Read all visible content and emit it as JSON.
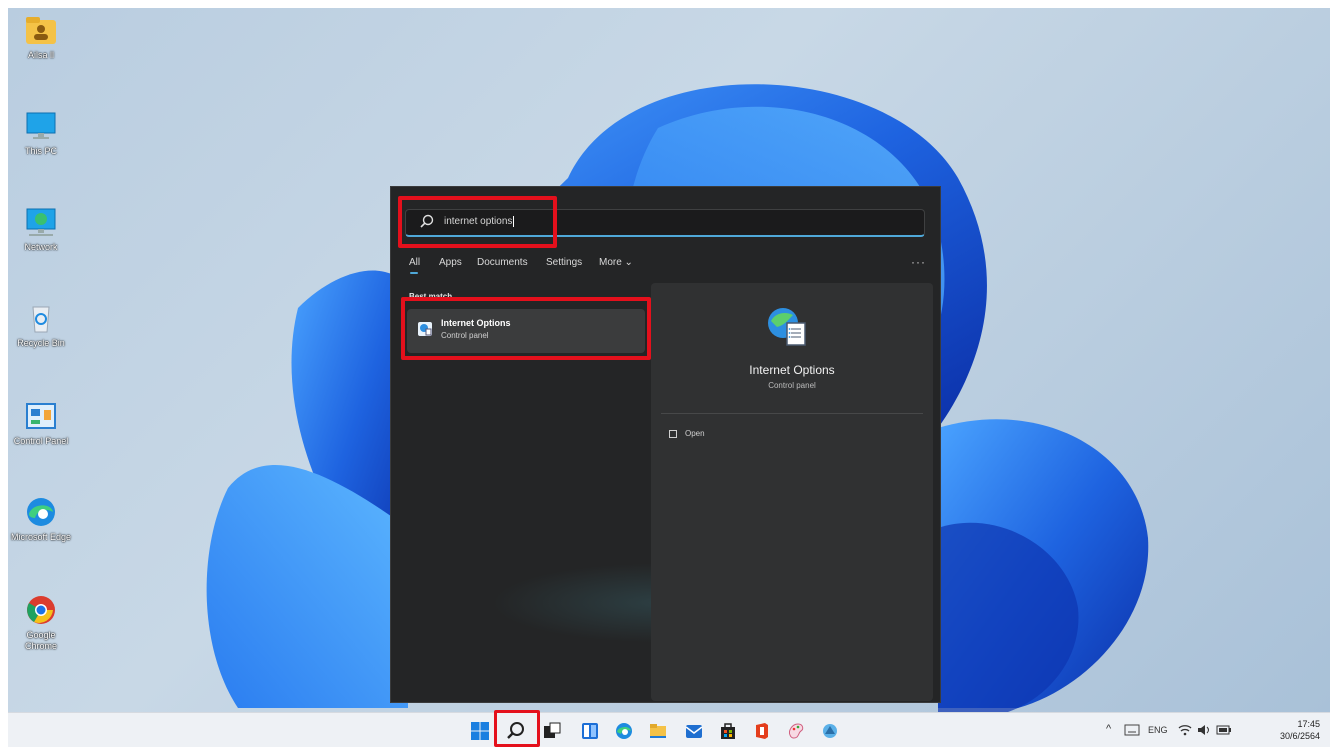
{
  "desktop": {
    "icons": [
      {
        "label": "Ailsa ll",
        "icon": "user-folder-icon"
      },
      {
        "label": "This PC",
        "icon": "computer-icon"
      },
      {
        "label": "Network",
        "icon": "network-icon"
      },
      {
        "label": "Recycle Bin",
        "icon": "recycle-bin-icon"
      },
      {
        "label": "Control Panel",
        "icon": "control-panel-icon"
      },
      {
        "label": "Microsoft Edge",
        "icon": "edge-icon"
      },
      {
        "label": "Google Chrome",
        "icon": "chrome-icon"
      }
    ]
  },
  "search": {
    "query": "internet options",
    "tabs": [
      "All",
      "Apps",
      "Documents",
      "Settings",
      "More ⌄"
    ],
    "active_tab": "All",
    "overflow": "···",
    "best_match_label": "Best match",
    "result": {
      "title": "Internet Options",
      "subtitle": "Control panel"
    },
    "preview": {
      "title": "Internet Options",
      "subtitle": "Control panel",
      "action": "Open"
    }
  },
  "taskbar": {
    "icons": [
      "windows-start-icon",
      "search-icon",
      "task-view-icon",
      "widgets-icon",
      "edge-icon",
      "file-explorer-icon",
      "mail-icon",
      "store-icon",
      "office-icon",
      "paint-icon",
      "app-icon"
    ],
    "tray": {
      "chevron": "^",
      "language": "ENG",
      "time": "17:45",
      "date": "30/6/2564"
    }
  },
  "highlight_color": "#e4101c"
}
